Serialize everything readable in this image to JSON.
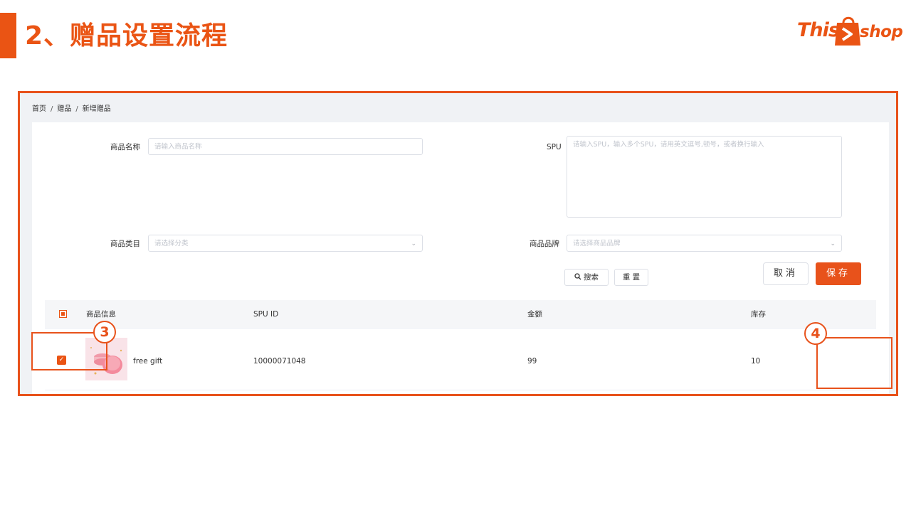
{
  "slide": {
    "title": "2、赠品设置流程",
    "logo_text_left": "This",
    "logo_text_right": "shop",
    "accent_color": "#ea5414"
  },
  "breadcrumb": [
    "首页",
    "赠品",
    "新增赠品"
  ],
  "breadcrumb_sep": "/",
  "form": {
    "product_name_label": "商品名称",
    "product_name_placeholder": "请输入商品名称",
    "spu_label": "SPU",
    "spu_placeholder": "请输入SPU，输入多个SPU，请用英文逗号,顿号，或者换行输入",
    "category_label": "商品类目",
    "category_placeholder": "请选择分类",
    "brand_label": "商品品牌",
    "brand_placeholder": "请选择商品品牌",
    "search_button": "搜索",
    "reset_button": "重 置"
  },
  "table": {
    "columns": [
      "商品信息",
      "SPU ID",
      "金额",
      "库存"
    ],
    "rows": [
      {
        "checked": true,
        "name": "free gift",
        "spu_id": "10000071048",
        "amount": "99",
        "stock": "10"
      }
    ]
  },
  "actions": {
    "cancel": "取消",
    "save": "保存"
  },
  "annotations": {
    "step3": "3",
    "step4": "4"
  }
}
